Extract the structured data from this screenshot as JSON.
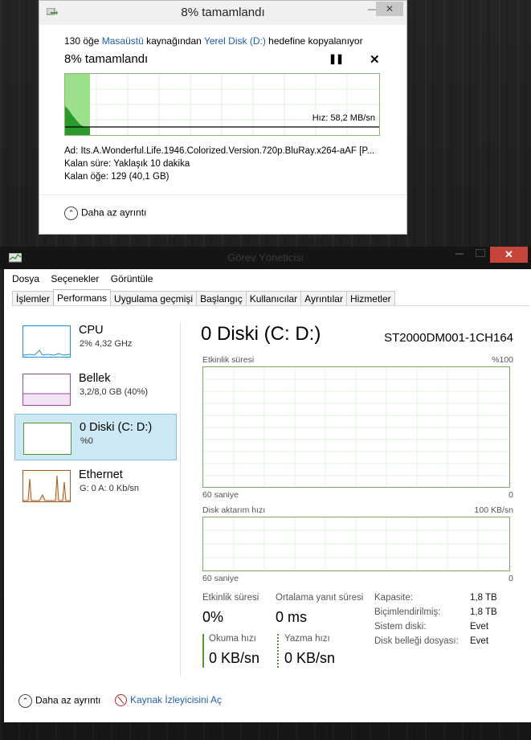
{
  "copy_dialog": {
    "title": "8%  tamamlandı",
    "desc_prefix": "130 öğe ",
    "source": "Masaüstü",
    "desc_middle": " kaynağından ",
    "destination": "Yerel Disk (D:)",
    "desc_suffix": " hedefine kopyalanıyor",
    "percent_text": "8%  tamamlandı",
    "progress_fraction": 0.08,
    "speed_text": "Hız: 58,2 MB/sn",
    "name_label": "Ad:",
    "name_value": "Its.A.Wonderful.Life.1946.Colorized.Version.720p.BluRay.x264-aAF [P...",
    "time_label": "Kalan süre:",
    "time_value": "Yaklaşık 10 dakika",
    "items_label": "Kalan öğe:",
    "items_value": "129 (40,1 GB)",
    "less_details": "Daha az ayrıntı"
  },
  "task_manager": {
    "title": "Görev Yöneticisi",
    "menu": [
      "Dosya",
      "Seçenekler",
      "Görüntüle"
    ],
    "tabs": [
      "İşlemler",
      "Performans",
      "Uygulama geçmişi",
      "Başlangıç",
      "Kullanıcılar",
      "Ayrıntılar",
      "Hizmetler"
    ],
    "active_tab": "Performans",
    "sidebar": [
      {
        "name": "CPU",
        "sub": "2% 4,32 GHz",
        "color": "#1f8fd1"
      },
      {
        "name": "Bellek",
        "sub": "3,2/8,0 GB (40%)",
        "color": "#9c47a8"
      },
      {
        "name": "0 Diski (C: D:)",
        "sub": "%0",
        "color": "#4f9a2c"
      },
      {
        "name": "Ethernet",
        "sub": "G: 0 A: 0 Kb/sn",
        "color": "#a8591b"
      }
    ],
    "disk_heading": "0 Diski (C: D:)",
    "disk_model": "ST2000DM001-1CH164",
    "graph1": {
      "label": "Etkinlik süresi",
      "max": "%100",
      "left": "60 saniye",
      "right": "0"
    },
    "graph2": {
      "label": "Disk aktarım hızı",
      "max": "100 KB/sn",
      "left": "60 saniye",
      "right": "0"
    },
    "stats": {
      "active_label": "Etkinlik süresi",
      "active_value": "0%",
      "response_label": "Ortalama yanıt süresi",
      "response_value": "0 ms",
      "read_label": "Okuma hızı",
      "read_value": "0 KB/sn",
      "write_label": "Yazma hızı",
      "write_value": "0 KB/sn"
    },
    "props": [
      {
        "label": "Kapasite:",
        "value": "1,8 TB"
      },
      {
        "label": "Biçimlendirilmiş:",
        "value": "1,8 TB"
      },
      {
        "label": "Sistem diski:",
        "value": "Evet"
      },
      {
        "label": "Disk belleği dosyası:",
        "value": "Evet"
      }
    ],
    "footer_less": "Daha az ayrıntı",
    "resmon": "Kaynak İzleyicisini Aç"
  }
}
